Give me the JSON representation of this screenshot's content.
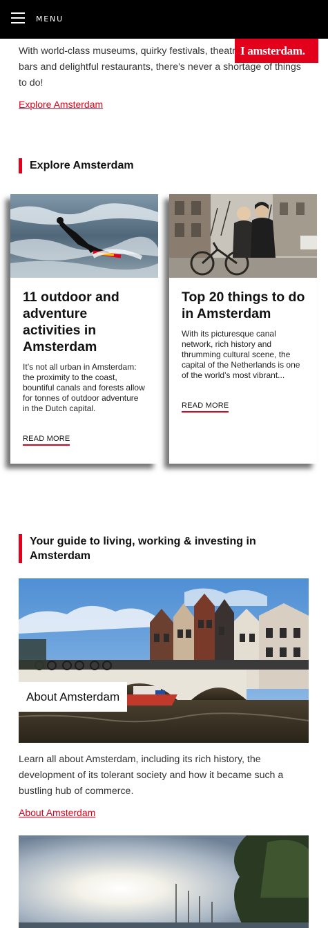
{
  "header": {
    "menu_label": "MENU",
    "logo_text": "I amsterdam."
  },
  "intro": {
    "text": "With world-class museums, quirky festivals, theatres, laid-back bars and delightful restaurants, there's never a shortage of things to do!",
    "link": "Explore Amsterdam"
  },
  "explore": {
    "heading": "Explore Amsterdam",
    "cards": [
      {
        "title": "11 outdoor and adventure activities in Amsterdam",
        "description": "It’s not all urban in Amsterdam: the proximity to the coast, bountiful canals and forests allow for tonnes of outdoor adventure in the Dutch capital.",
        "more": "READ MORE"
      },
      {
        "title": "Top 20 things to do in Amsterdam",
        "description": "With its picturesque canal network, rich history and thrumming cultural scene, the capital of the Netherlands is one of the world’s most vibrant...",
        "more": "READ MORE"
      }
    ]
  },
  "guide": {
    "heading": "Your guide to living, working & investing in Amsterdam",
    "feature_label": "About Amsterdam",
    "text": "Learn all about Amsterdam, including its rich history, the development of its tolerant society and how it became such a bustling hub of commerce.",
    "link": "About Amsterdam"
  },
  "colors": {
    "brand_red": "#e2001a",
    "topbar": "#000000"
  }
}
